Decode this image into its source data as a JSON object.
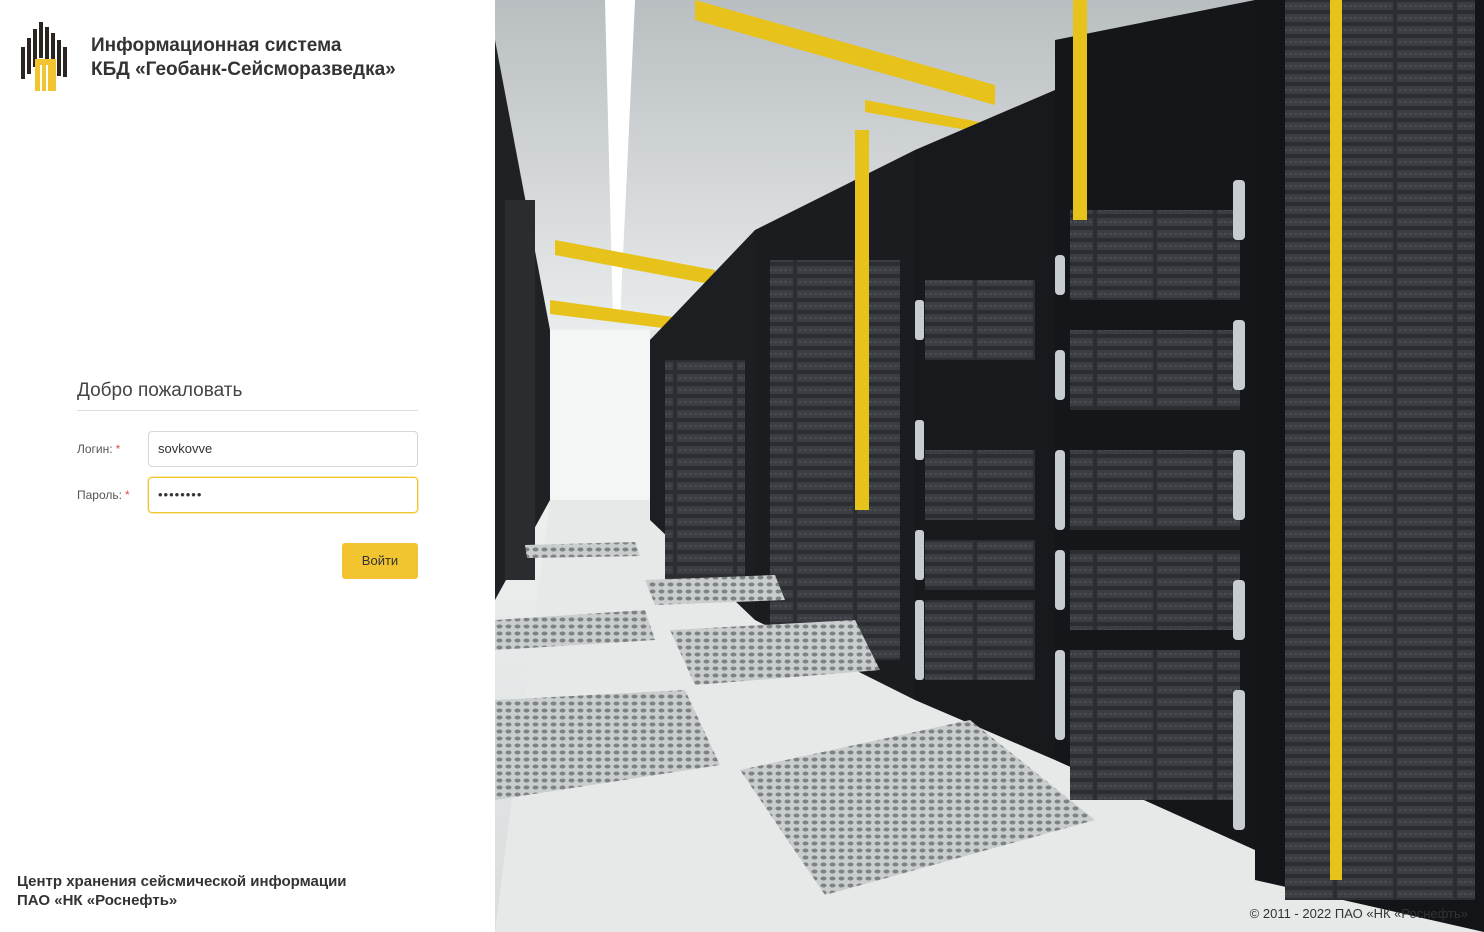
{
  "app": {
    "title_line1": "Информационная система",
    "title_line2": "КБД «Геобанк-Сейсморазведка»"
  },
  "login": {
    "heading": "Добро пожаловать",
    "login_label": "Логин:",
    "login_value": "sovkovve",
    "password_label": "Пароль:",
    "password_mask": "••••••••",
    "required_mark": "*",
    "submit_label": "Войти"
  },
  "footer": {
    "org_line1": "Центр хранения сейсмической информации",
    "org_line2": "ПАО «НК «Роснефть»",
    "copyright": "© 2011 - 2022 ПАО «НК «Роснефть»"
  },
  "colors": {
    "accent": "#f2c530",
    "logo_yellow": "#f2c530",
    "logo_dark": "#2b2522",
    "text": "#333333"
  },
  "icons": {
    "logo": "rosneft-logo-icon"
  }
}
